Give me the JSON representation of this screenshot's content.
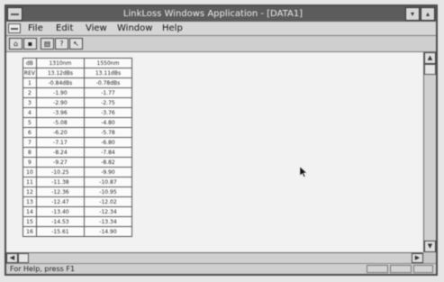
{
  "window": {
    "title": "LinkLoss Windows Application - [DATA1]",
    "min_glyph": "▾",
    "max_glyph": "▴"
  },
  "menu": {
    "items": [
      "File",
      "Edit",
      "View",
      "Window",
      "Help"
    ]
  },
  "toolbar": {
    "tools": [
      {
        "icon": "open-icon",
        "glyph": "⌂"
      },
      {
        "icon": "save-icon",
        "glyph": "▪"
      },
      {
        "icon": "print-icon",
        "glyph": "▤"
      },
      {
        "icon": "help-icon",
        "glyph": "?"
      },
      {
        "icon": "context-help-icon",
        "glyph": "↖"
      }
    ]
  },
  "table": {
    "header_rows": [
      [
        "dB",
        "1310nm",
        "1550nm"
      ],
      [
        "REV",
        "13.12dBs",
        "13.11dBs"
      ]
    ],
    "rows": [
      [
        "1",
        "-0.84dBs",
        "-0.78dBs"
      ],
      [
        "2",
        "-1.90",
        "-1.77"
      ],
      [
        "3",
        "-2.90",
        "-2.75"
      ],
      [
        "4",
        "-3.96",
        "-3.76"
      ],
      [
        "5",
        "-5.08",
        "-4.80"
      ],
      [
        "6",
        "-6.20",
        "-5.78"
      ],
      [
        "7",
        "-7.17",
        "-6.80"
      ],
      [
        "8",
        "-8.24",
        "-7.84"
      ],
      [
        "9",
        "-9.27",
        "-8.82"
      ],
      [
        "10",
        "-10.25",
        "-9.90"
      ],
      [
        "11",
        "-11.38",
        "-10.87"
      ],
      [
        "12",
        "-12.36",
        "-10.95"
      ],
      [
        "13",
        "-12.47",
        "-12.02"
      ],
      [
        "14",
        "-13.40",
        "-12.34"
      ],
      [
        "15",
        "-14.53",
        "-13.34"
      ],
      [
        "16",
        "-15.61",
        "-14.90"
      ]
    ]
  },
  "scroll": {
    "up": "▲",
    "down": "▼",
    "left": "◀",
    "right": "▶"
  },
  "status": {
    "help_text": "For Help, press F1"
  }
}
